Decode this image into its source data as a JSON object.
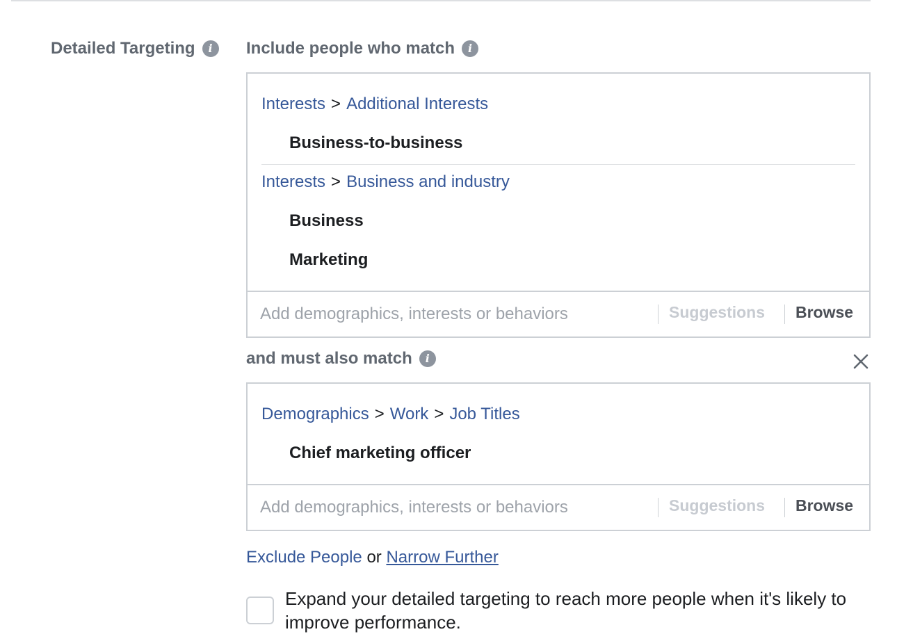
{
  "section": {
    "label": "Detailed Targeting",
    "info_icon": "info-icon"
  },
  "include": {
    "title": "Include people who match",
    "groups": [
      {
        "crumbs": [
          "Interests",
          "Additional Interests"
        ],
        "items": [
          "Business-to-business"
        ]
      },
      {
        "crumbs": [
          "Interests",
          "Business and industry"
        ],
        "items": [
          "Business",
          "Marketing"
        ]
      }
    ],
    "input_placeholder": "Add demographics, interests or behaviors",
    "suggestions_label": "Suggestions",
    "browse_label": "Browse"
  },
  "narrow": {
    "title": "and must also match",
    "close_icon": "close-icon",
    "groups": [
      {
        "crumbs": [
          "Demographics",
          "Work",
          "Job Titles"
        ],
        "items": [
          "Chief marketing officer"
        ]
      }
    ],
    "input_placeholder": "Add demographics, interests or behaviors",
    "suggestions_label": "Suggestions",
    "browse_label": "Browse"
  },
  "footer": {
    "exclude_label": "Exclude People",
    "or_label": "or",
    "narrow_label": "Narrow Further",
    "expand_text": "Expand your detailed targeting to reach more people when it's likely to improve performance.",
    "expand_checked": false
  },
  "colors": {
    "link": "#365899",
    "label": "#606770",
    "border": "#ccd0d5"
  }
}
